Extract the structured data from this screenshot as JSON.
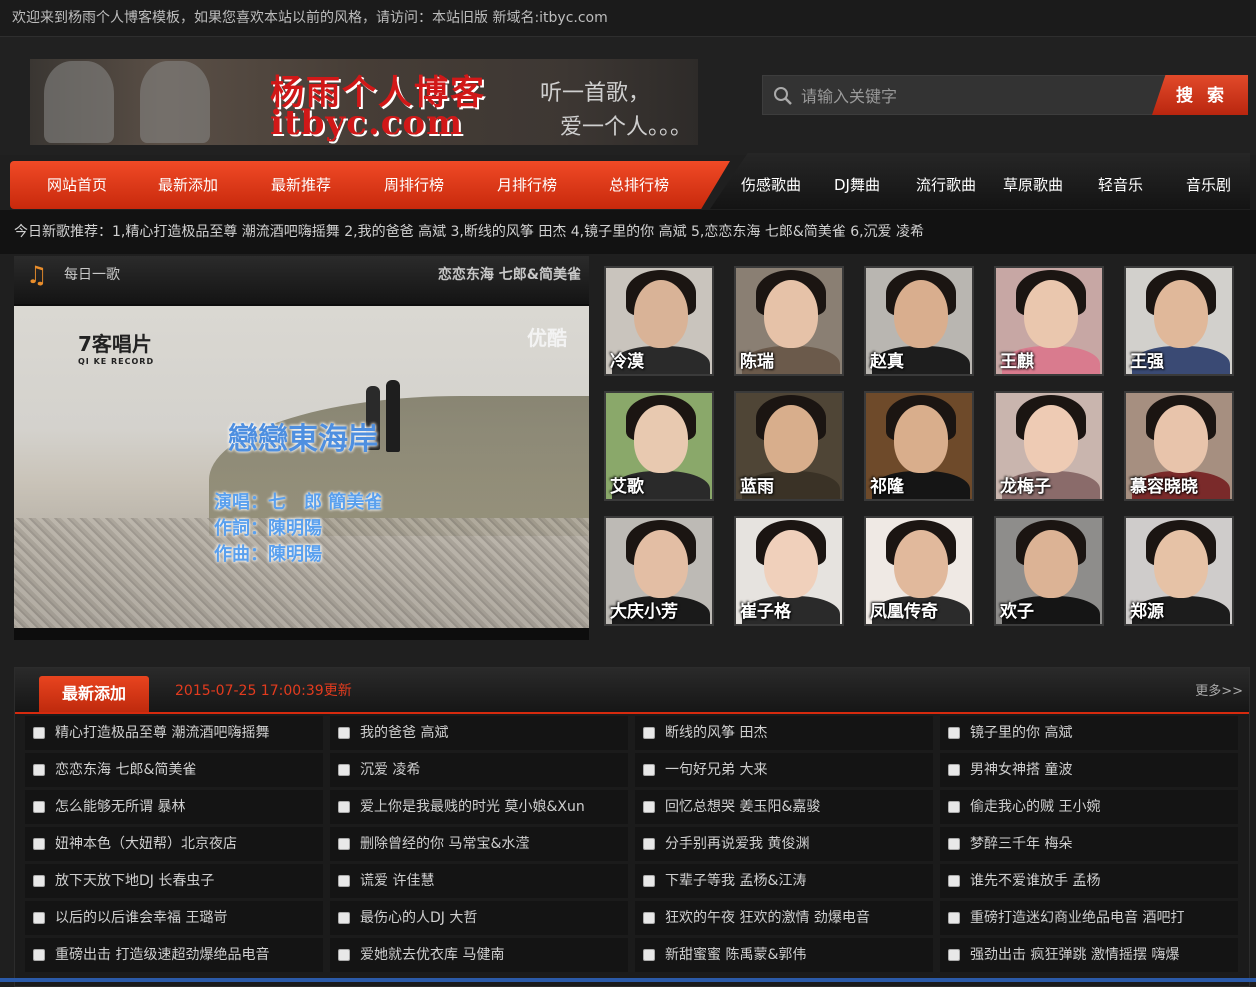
{
  "topbar": {
    "text": "欢迎来到杨雨个人博客模板，如果您喜欢本站以前的风格，请访问：本站旧版 新域名:itbyc.com"
  },
  "logo": {
    "title": "杨雨个人博客",
    "domain": "itbyc.com",
    "slogan1": "听一首歌，",
    "slogan2": "爱一个人。。。"
  },
  "search": {
    "placeholder": "请输入关键字",
    "button": "搜 索",
    "icon": "search-icon"
  },
  "nav": {
    "main": [
      "网站首页",
      "最新添加",
      "最新推荐",
      "周排行榜",
      "月排行榜",
      "总排行榜"
    ],
    "genres": [
      "伤感歌曲",
      "DJ舞曲",
      "流行歌曲",
      "草原歌曲",
      "轻音乐",
      "音乐剧"
    ]
  },
  "marquee": {
    "text": "今日新歌推荐：1,精心打造极品至尊 潮流酒吧嗨摇舞 2,我的爸爸 高斌 3,断线的风筝 田杰 4,镜子里的你 高斌 5,恋恋东海 七郎&简美雀 6,沉爱 凌希"
  },
  "daily": {
    "label": "每日一歌",
    "icon": "music-note-icon",
    "song": "恋恋东海 七郎&简美雀",
    "video": {
      "record_label": "7客唱片",
      "record_label_en": "QI KE RECORD",
      "watermark": "优酷",
      "title": "戀戀東海岸",
      "credit_singer": "演唱：七　郎 簡美雀",
      "credit_lyrics": "作詞：陳明陽",
      "credit_music": "作曲：陳明陽"
    }
  },
  "artists": [
    {
      "name": "冷漠",
      "skin": "#d9b397",
      "body": "#2a2a2a",
      "bg": "#c9c4bd"
    },
    {
      "name": "陈瑞",
      "skin": "#e6c2a8",
      "body": "#6b5a4b",
      "bg": "#8a7f73"
    },
    {
      "name": "赵真",
      "skin": "#d9ae8e",
      "body": "#1d1d1d",
      "bg": "#b9b6b1"
    },
    {
      "name": "王麒",
      "skin": "#eac7ae",
      "body": "#d97b8e",
      "bg": "#c7a7a4"
    },
    {
      "name": "王强",
      "skin": "#e0b89a",
      "body": "#3a4a74",
      "bg": "#d2d0cc"
    },
    {
      "name": "艾歌",
      "skin": "#e8c9b0",
      "body": "#2a2a2a",
      "bg": "#8aa86a"
    },
    {
      "name": "蓝雨",
      "skin": "#d8ae8c",
      "body": "#3a3226",
      "bg": "#4f4536"
    },
    {
      "name": "祁隆",
      "skin": "#d9ae8c",
      "body": "#151515",
      "bg": "#6e4a2a"
    },
    {
      "name": "龙梅子",
      "skin": "#eecbb4",
      "body": "#8a6b6a",
      "bg": "#c9b5ae"
    },
    {
      "name": "慕容晓晓",
      "skin": "#e8c4ab",
      "body": "#7a2a2a",
      "bg": "#a68f80"
    },
    {
      "name": "大庆小芳",
      "skin": "#e3bea4",
      "body": "#1a1a1a",
      "bg": "#bdbab5"
    },
    {
      "name": "崔子格",
      "skin": "#f0d0bb",
      "body": "#2a2a2a",
      "bg": "#e6e3df"
    },
    {
      "name": "凤凰传奇",
      "skin": "#e1b99c",
      "body": "#2b2b2b",
      "bg": "#efe9e4"
    },
    {
      "name": "欢子",
      "skin": "#dcb395",
      "body": "#151515",
      "bg": "#8e8d8b"
    },
    {
      "name": "郑源",
      "skin": "#e6c2a6",
      "body": "#1c1c1c",
      "bg": "#cfcccb"
    }
  ],
  "latest": {
    "tab": "最新添加",
    "updated": "2015-07-25 17:00:39更新",
    "more": "更多>>",
    "songs": [
      "精心打造极品至尊 潮流酒吧嗨摇舞",
      "我的爸爸 高斌",
      "断线的风筝 田杰",
      "镜子里的你 高斌",
      "恋恋东海 七郎&简美雀",
      "沉爱 凌希",
      "一句好兄弟 大来",
      "男神女神搭 童波",
      "怎么能够无所谓 暴林",
      "爱上你是我最贱的时光 莫小娘&Xun",
      "回忆总想哭 姜玉阳&嘉骏",
      "偷走我心的贼 王小婉",
      "妞神本色（大妞帮）北京夜店",
      "删除曾经的你 马常宝&水滢",
      "分手别再说爱我 黄俊渊",
      "梦醉三千年 梅朵",
      "放下天放下地DJ 长春虫子",
      "谎爱 许佳慧",
      "下辈子等我 孟杨&江涛",
      "谁先不爱谁放手 孟杨",
      "以后的以后谁会幸福 王璐岢",
      "最伤心的人DJ 大哲",
      "狂欢的午夜 狂欢的激情 劲爆电音",
      "重磅打造迷幻商业绝品电音 酒吧打",
      "重磅出击 打造级速超劲爆绝品电音",
      "爱她就去优衣库 马健南",
      "新甜蜜蜜 陈禹蒙&郭伟",
      "强劲出击 疯狂弹跳 激情摇摆 嗨爆"
    ]
  }
}
